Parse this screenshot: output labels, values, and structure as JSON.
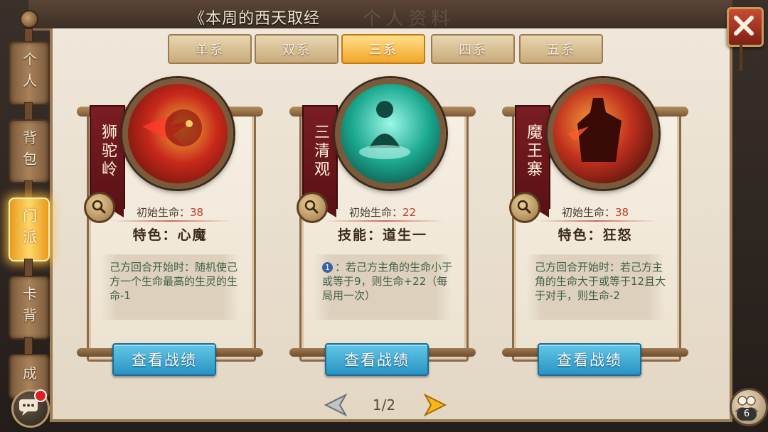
{
  "header": {
    "title": "《本周的西天取经",
    "watermark": "个人资料"
  },
  "side_tabs": [
    {
      "label": "个人",
      "active": false
    },
    {
      "label": "背包",
      "active": false
    },
    {
      "label": "门派",
      "active": true
    },
    {
      "label": "卡背",
      "active": false
    },
    {
      "label": "成",
      "active": false
    }
  ],
  "top_tabs": [
    {
      "label": "单系",
      "active": false
    },
    {
      "label": "双系",
      "active": false
    },
    {
      "label": "三系",
      "active": true
    },
    {
      "label": "四系",
      "active": false
    },
    {
      "label": "五系",
      "active": false
    }
  ],
  "cards": [
    {
      "name": "狮驼岭",
      "hp_label": "初始生命：",
      "hp_value": "38",
      "feature": "特色：心魔",
      "desc": "己方回合开始时：随机使己方一个生命最高的生灵的生命-1",
      "button": "查看战绩",
      "portrait_colors": [
        "#f0b33a",
        "#c8281a",
        "#4a0e08"
      ]
    },
    {
      "name": "三清观",
      "hp_label": "初始生命：",
      "hp_value": "22",
      "feature": "技能：道生一",
      "badge": "1",
      "desc": "：若己方主角的生命小于或等于9，则生命+22（每局用一次）",
      "button": "查看战绩",
      "portrait_colors": [
        "#9cf7e8",
        "#1aa88e",
        "#0c3a34"
      ]
    },
    {
      "name": "魔王寨",
      "hp_label": "初始生命：",
      "hp_value": "38",
      "feature": "特色：狂怒",
      "desc": "己方回合开始时：若己方主角的生命大于或等于12且大于对手，则生命-2",
      "button": "查看战绩",
      "portrait_colors": [
        "#f6a03a",
        "#c0301e",
        "#2a0806"
      ]
    }
  ],
  "pagination": {
    "text": "1/2"
  },
  "friends": {
    "count": "6"
  },
  "colors": {
    "active_tab": "#f2a52a",
    "hp_number": "#c33a28",
    "desc_text": "#3f5e48",
    "button_blue": "#2a93c4",
    "ribbon_red": "#7a1e22"
  }
}
